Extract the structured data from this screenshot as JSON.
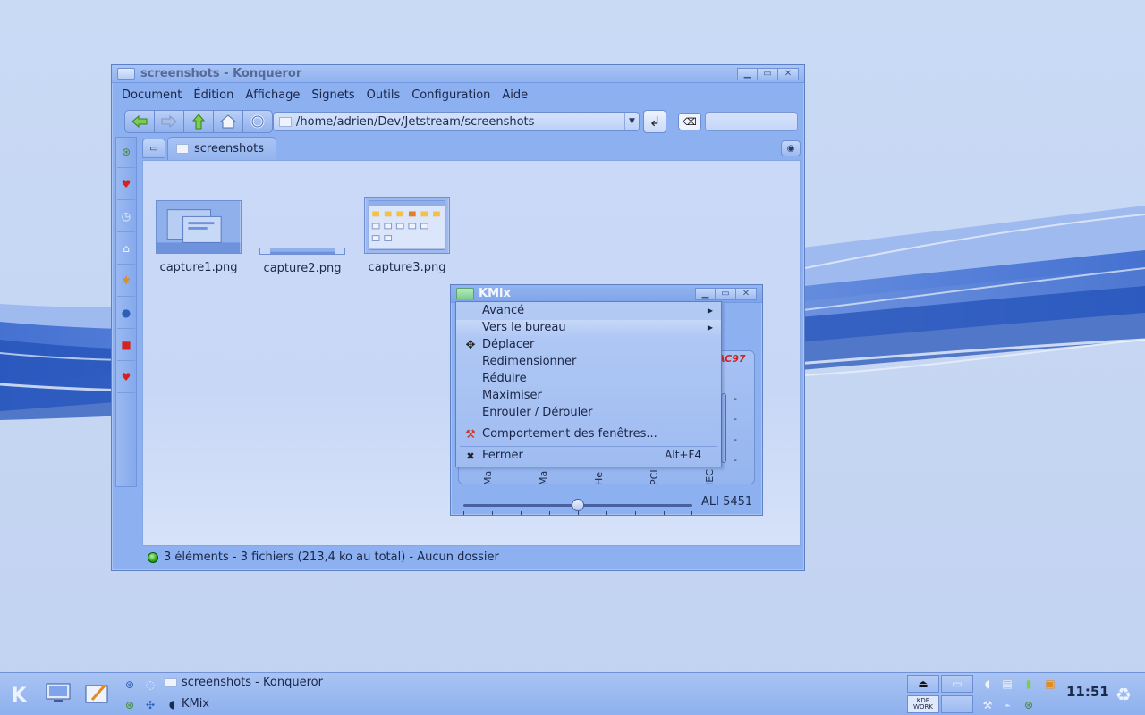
{
  "colors": {
    "desktop_bg": "#c5d6f3",
    "window_bg": "#8cb0f0",
    "accent_dark": "#1d3f9e",
    "status_led": "#27a321"
  },
  "konqueror": {
    "title": "screenshots - Konqueror",
    "menu": [
      "Document",
      "Édition",
      "Affichage",
      "Signets",
      "Outils",
      "Configuration",
      "Aide"
    ],
    "nav_icons": [
      "back-arrow-icon",
      "forward-arrow-icon",
      "up-arrow-icon",
      "home-icon",
      "reload-icon"
    ],
    "location": "/home/adrien/Dev/Jetstream/screenshots",
    "tab_label": "screenshots",
    "files": [
      {
        "name": "capture1.png"
      },
      {
        "name": "capture2.png"
      },
      {
        "name": "capture3.png"
      }
    ],
    "status": "3 éléments - 3 fichiers (213,4 ko au total) - Aucun dossier",
    "sidebar_icons": [
      "applications-icon",
      "bookmarks-heart-icon",
      "history-clock-icon",
      "home-folder-icon",
      "services-icon",
      "network-globe-icon",
      "root-folder-icon",
      "favorites-heart-icon"
    ]
  },
  "kmix": {
    "title": "KMix",
    "logo": "AC97",
    "channels": [
      "Ma",
      "Ma",
      "He",
      "PCI",
      "IEC"
    ],
    "ticks": [
      "-",
      "-",
      "-",
      "-"
    ],
    "device": "ALI 5451",
    "volume_position": 0.5
  },
  "context_menu": {
    "items": [
      {
        "label": "Avancé",
        "submenu": true
      },
      {
        "label": "Vers le bureau",
        "submenu": true
      },
      {
        "label": "Déplacer",
        "icon": "move-icon"
      },
      {
        "label": "Redimensionner"
      },
      {
        "label": "Réduire"
      },
      {
        "label": "Maximiser"
      },
      {
        "label": "Enrouler / Dérouler"
      },
      {
        "label": "Comportement des fenêtres...",
        "icon": "tools-icon"
      },
      {
        "label": "Fermer",
        "icon": "close-icon",
        "shortcut": "Alt+F4"
      }
    ]
  },
  "taskbar": {
    "tasks": [
      {
        "label": "screenshots - Konqueror"
      },
      {
        "label": "KMix"
      }
    ],
    "clock": "11:51",
    "kde_badge": "KDE WORK"
  }
}
